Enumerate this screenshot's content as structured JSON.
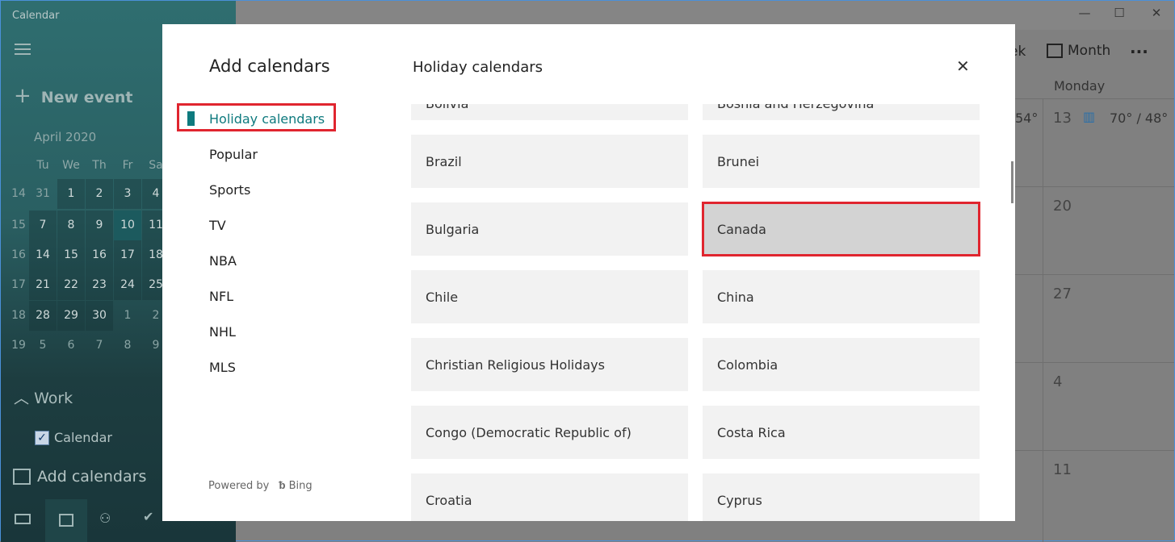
{
  "app": {
    "title": "Calendar",
    "window_controls": [
      "minimize",
      "maximize",
      "close"
    ]
  },
  "sidebar": {
    "new_event": "New event",
    "month_label": "April 2020",
    "weekday_headers": [
      "Tu",
      "We",
      "Th",
      "Fr",
      "Sa"
    ],
    "weeks": [
      {
        "num": "14",
        "days": [
          "31",
          "1",
          "2",
          "3",
          "4"
        ]
      },
      {
        "num": "15",
        "days": [
          "7",
          "8",
          "9",
          "10",
          "11"
        ]
      },
      {
        "num": "16",
        "days": [
          "14",
          "15",
          "16",
          "17",
          "18"
        ]
      },
      {
        "num": "17",
        "days": [
          "21",
          "22",
          "23",
          "24",
          "25"
        ]
      },
      {
        "num": "18",
        "days": [
          "28",
          "29",
          "30",
          "1",
          "2"
        ]
      },
      {
        "num": "19",
        "days": [
          "5",
          "6",
          "7",
          "8",
          "9"
        ]
      }
    ],
    "group": "Work",
    "calendar_item": "Calendar",
    "add_calendars": "Add calendars"
  },
  "toolbar": {
    "week_partial": "ek",
    "month": "Month",
    "more": "..."
  },
  "month_view": {
    "column_header": "Monday",
    "partial_temp": "54°",
    "days": [
      "13",
      "20",
      "27",
      "4",
      "11"
    ],
    "weather": "70° / 48°"
  },
  "dialog": {
    "title": "Add calendars",
    "section_title": "Holiday calendars",
    "nav": [
      "Holiday calendars",
      "Popular",
      "Sports",
      "TV",
      "NBA",
      "NFL",
      "NHL",
      "MLS"
    ],
    "selected_nav": "Holiday calendars",
    "powered_by": "Powered by",
    "bing": "Bing",
    "tiles": [
      [
        "Bolivia",
        "Bosnia and Herzegovina"
      ],
      [
        "Brazil",
        "Brunei"
      ],
      [
        "Bulgaria",
        "Canada"
      ],
      [
        "Chile",
        "China"
      ],
      [
        "Christian Religious Holidays",
        "Colombia"
      ],
      [
        "Congo (Democratic Republic of)",
        "Costa Rica"
      ],
      [
        "Croatia",
        "Cyprus"
      ]
    ],
    "highlighted_tile": "Canada"
  },
  "colors": {
    "accent": "#0e7a7e",
    "highlight": "#e0252f"
  }
}
